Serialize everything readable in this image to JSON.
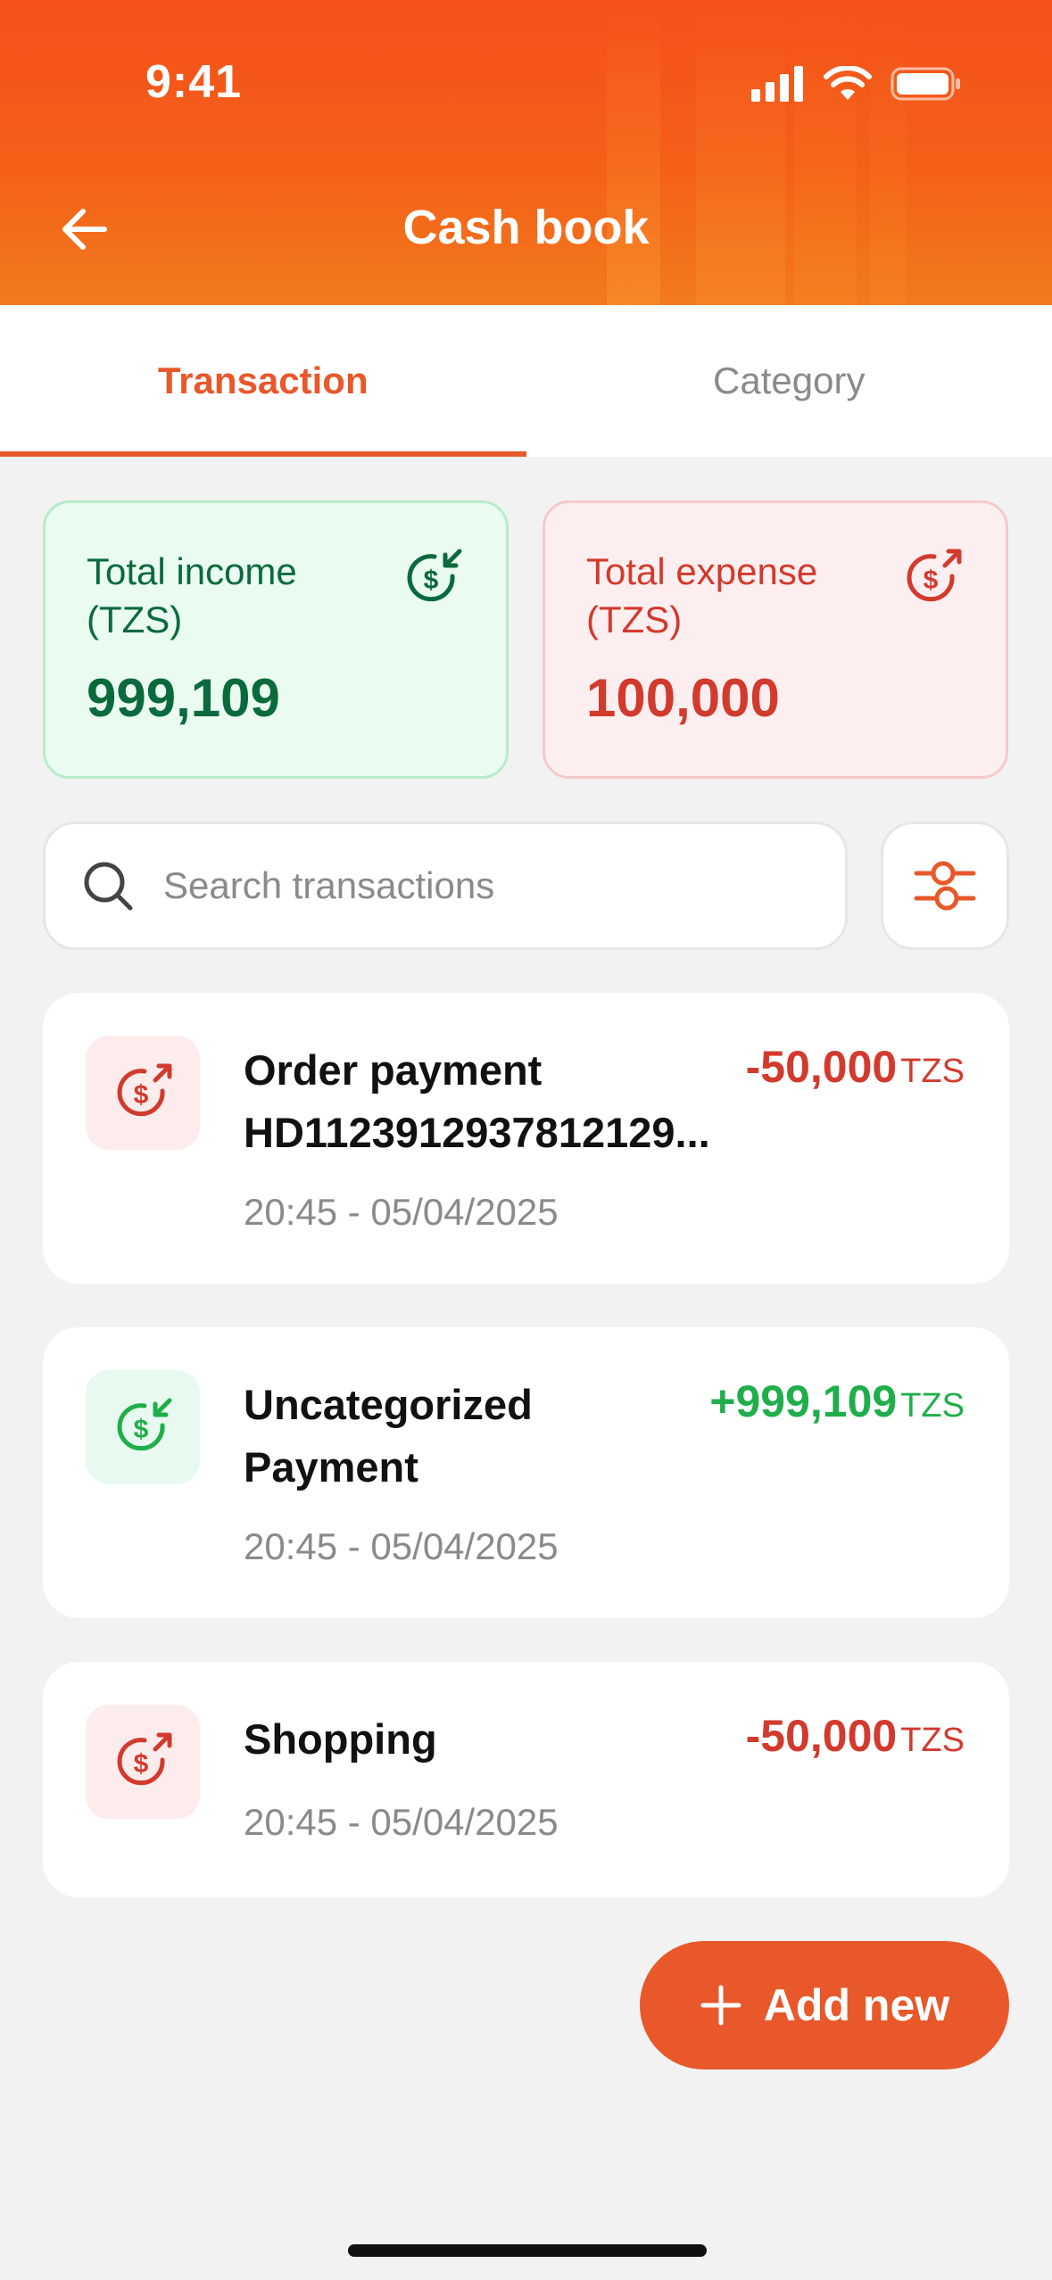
{
  "status_bar": {
    "time": "9:41",
    "icons": [
      "signal-icon",
      "wifi-icon",
      "battery-icon"
    ]
  },
  "header": {
    "title": "Cash book",
    "back_icon": "arrow-left-icon"
  },
  "tabs": [
    {
      "label": "Transaction",
      "active": true
    },
    {
      "label": "Category",
      "active": false
    }
  ],
  "summary": {
    "income": {
      "label": "Total income",
      "unit": "(TZS)",
      "amount": "999,109",
      "icon": "dollar-in-icon",
      "color": "#0b6a3c"
    },
    "expense": {
      "label": "Total expense",
      "unit": "(TZS)",
      "amount": "100,000",
      "icon": "dollar-out-icon",
      "color": "#d23a2e"
    }
  },
  "search": {
    "placeholder": "Search transactions",
    "value": "",
    "filter_icon": "sliders-icon"
  },
  "transactions": [
    {
      "title_line1": "Order payment",
      "title_line2": "HD1123912937812129...",
      "time": "20:45 - 05/04/2025",
      "amount": "-50,000",
      "currency": "TZS",
      "type": "expense"
    },
    {
      "title_line1": "Uncategorized",
      "title_line2": "Payment",
      "time": "20:45 - 05/04/2025",
      "amount": "+999,109",
      "currency": "TZS",
      "type": "income"
    },
    {
      "title_line1": "Shopping",
      "time": "20:45 - 05/04/2025",
      "amount": "-50,000",
      "currency": "TZS",
      "type": "expense"
    }
  ],
  "add_button": {
    "label": "Add new",
    "icon": "plus-icon"
  },
  "colors": {
    "brand": "#e8582a",
    "income": "#1fae4a",
    "expense": "#d23a2e"
  }
}
